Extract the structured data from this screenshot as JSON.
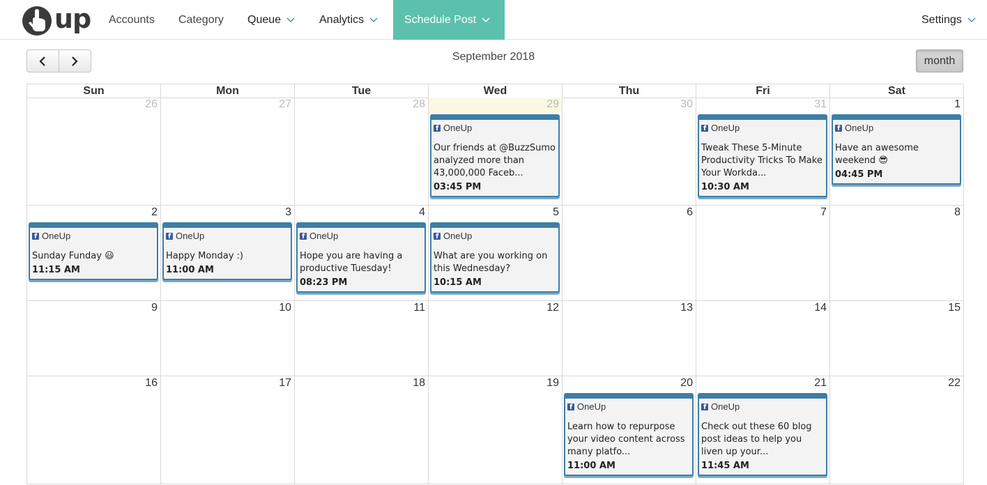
{
  "nav": {
    "logo_text": "up",
    "accounts": "Accounts",
    "category": "Category",
    "queue": "Queue",
    "analytics": "Analytics",
    "schedule_post": "Schedule Post",
    "settings": "Settings"
  },
  "toolbar": {
    "title": "September 2018",
    "month_label": "month",
    "prev_icon": "chevron-left-icon",
    "next_icon": "chevron-right-icon"
  },
  "colors": {
    "accent": "#5bc0ac",
    "event_border": "#3d7ea6",
    "today": "#fcf8e3",
    "facebook": "#3b5998"
  },
  "weekdays": [
    "Sun",
    "Mon",
    "Tue",
    "Wed",
    "Thu",
    "Fri",
    "Sat"
  ],
  "weeks": [
    [
      {
        "day": "26",
        "other": true
      },
      {
        "day": "27",
        "other": true
      },
      {
        "day": "28",
        "other": true
      },
      {
        "day": "29",
        "other": true,
        "today": true,
        "event": {
          "account": "OneUp",
          "text": "Our friends at @BuzzSumo analyzed more than 43,000,000 Faceb...",
          "time": "03:45 PM"
        }
      },
      {
        "day": "30",
        "other": true
      },
      {
        "day": "31",
        "other": true,
        "event": {
          "account": "OneUp",
          "text": "Tweak These 5-Minute Productivity Tricks To Make Your Workda...",
          "time": "10:30 AM"
        }
      },
      {
        "day": "1",
        "event": {
          "account": "OneUp",
          "text": "Have an awesome weekend 😎",
          "time": "04:45 PM"
        }
      }
    ],
    [
      {
        "day": "2",
        "event": {
          "account": "OneUp",
          "text": "Sunday Funday 😃",
          "time": "11:15 AM"
        }
      },
      {
        "day": "3",
        "event": {
          "account": "OneUp",
          "text": "Happy Monday :)",
          "time": "11:00 AM"
        }
      },
      {
        "day": "4",
        "event": {
          "account": "OneUp",
          "text": "Hope you are having a productive Tuesday!",
          "time": "08:23 PM"
        }
      },
      {
        "day": "5",
        "event": {
          "account": "OneUp",
          "text": "What are you working on this Wednesday?",
          "time": "10:15 AM"
        }
      },
      {
        "day": "6"
      },
      {
        "day": "7"
      },
      {
        "day": "8"
      }
    ],
    [
      {
        "day": "9"
      },
      {
        "day": "10"
      },
      {
        "day": "11"
      },
      {
        "day": "12"
      },
      {
        "day": "13"
      },
      {
        "day": "14"
      },
      {
        "day": "15"
      }
    ],
    [
      {
        "day": "16"
      },
      {
        "day": "17"
      },
      {
        "day": "18"
      },
      {
        "day": "19"
      },
      {
        "day": "20",
        "event": {
          "account": "OneUp",
          "text": "Learn how to repurpose your video content across many platfo...",
          "time": "11:00 AM"
        }
      },
      {
        "day": "21",
        "event": {
          "account": "OneUp",
          "text": "Check out these 60 blog post ideas to help you liven up your...",
          "time": "11:45 AM"
        }
      },
      {
        "day": "22"
      }
    ]
  ]
}
